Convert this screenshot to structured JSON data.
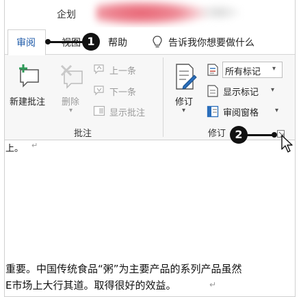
{
  "window": {
    "title": "企划"
  },
  "tabs": [
    {
      "label": "审阅",
      "active": true
    },
    {
      "label": "视图",
      "active": false
    },
    {
      "label": "帮助",
      "active": false
    }
  ],
  "tellme": {
    "label": "告诉我你想要做什么"
  },
  "comments_group": {
    "label": "批注",
    "new_comment": "新建批注",
    "delete": "删除",
    "previous": "上一条",
    "next": "下一条",
    "show_comments": "显示批注"
  },
  "tracking_group": {
    "label": "修订",
    "track_changes": "修订",
    "display_markup": "所有标记",
    "show_markup": "显示标记",
    "reviewing_pane": "审阅窗格",
    "dropdown_arrow": "▾"
  },
  "callouts": {
    "one": "1",
    "two": "2"
  },
  "document": {
    "line_top": "上。",
    "line1": "重要。中国传统食品“粥”为主要产品的系列产品虽然",
    "line2": "E市场上大行其道。取得很好的效益。"
  },
  "colors": {
    "accent": "#1e5aa8",
    "callout": "#111111"
  }
}
